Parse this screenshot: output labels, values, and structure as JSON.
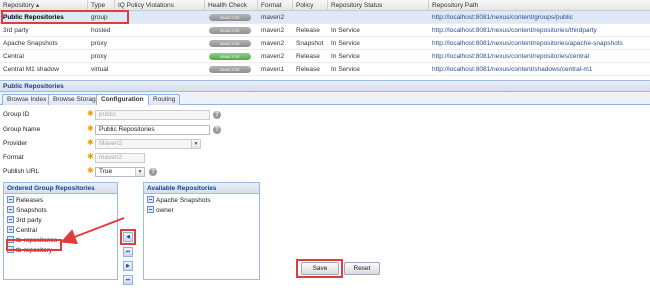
{
  "grid": {
    "columns": [
      "Repository ▴",
      "Type",
      "IQ Policy Violations",
      "Health Check",
      "Format",
      "Policy",
      "Repository Status",
      "Repository Path"
    ],
    "rows": [
      {
        "name": "Public Repositories",
        "type": "group",
        "health": "ANALYZE",
        "format": "maven2",
        "policy": "",
        "status": "",
        "path": "http://localhost:8081/nexus/content/groups/public"
      },
      {
        "name": "3rd party",
        "type": "hosted",
        "health": "ANALYZE",
        "format": "maven2",
        "policy": "Release",
        "status": "In Service",
        "path": "http://localhost:8081/nexus/content/repositories/thirdparty"
      },
      {
        "name": "Apache Snapshots",
        "type": "proxy",
        "health": "ANALYZE",
        "format": "maven2",
        "policy": "Snapshot",
        "status": "In Service",
        "path": "http://localhost:8081/nexus/content/repositories/apache-snapshots"
      },
      {
        "name": "Central",
        "type": "proxy",
        "health": "ANALYZE",
        "format": "maven2",
        "policy": "Release",
        "status": "In Service",
        "path": "http://localhost:8081/nexus/content/repositories/central"
      },
      {
        "name": "Central M1 shadow",
        "type": "virtual",
        "health": "ANALYZE",
        "format": "maven1",
        "policy": "Release",
        "status": "In Service",
        "path": "http://localhost:8081/nexus/content/shadows/central-m1"
      }
    ]
  },
  "panel": {
    "title": "Public Repositories",
    "tabs": [
      "Browse Index",
      "Browse Storage",
      "Configuration",
      "Routing"
    ]
  },
  "form": {
    "group_id": {
      "label": "Group ID",
      "value": "public"
    },
    "group_name": {
      "label": "Group Name",
      "value": "Public Repositories"
    },
    "provider": {
      "label": "Provider",
      "value": "Maven2"
    },
    "format": {
      "label": "Format",
      "value": "maven2"
    },
    "publish_url": {
      "label": "Publish URL",
      "value": "True"
    },
    "help_glyph": "?",
    "dropdown_glyph": "▼"
  },
  "ordered": {
    "title": "Ordered Group Repositories",
    "items": [
      "Releases",
      "Snapshots",
      "3rd party",
      "Central",
      "tb-repositories",
      "tb-repository"
    ]
  },
  "available": {
    "title": "Available Repositories",
    "items": [
      "Apache Snapshots",
      "owner"
    ]
  },
  "move_buttons": [
    "◀",
    "⏮",
    "▶",
    "⏭"
  ],
  "buttons": {
    "save": "Save",
    "reset": "Reset"
  },
  "colors": {
    "highlight": "#e23b3b",
    "selected_row": "#dfe8f6",
    "panel_header": "#15428b"
  }
}
